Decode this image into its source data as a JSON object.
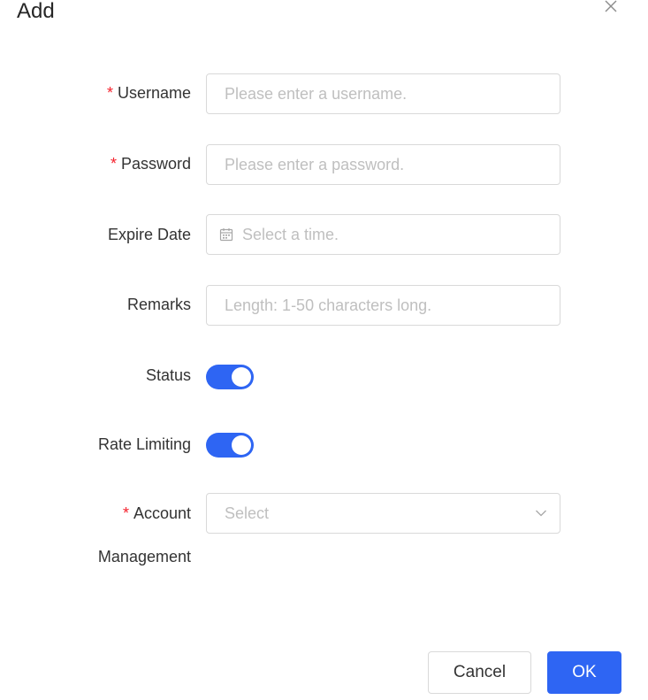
{
  "dialog": {
    "title": "Add",
    "close_icon": "close-icon"
  },
  "form": {
    "username": {
      "required_mark": "*",
      "label": "Username",
      "placeholder": "Please enter a username.",
      "value": ""
    },
    "password": {
      "required_mark": "*",
      "label": "Password",
      "placeholder": "Please enter a password.",
      "value": ""
    },
    "expire_date": {
      "label": "Expire Date",
      "placeholder": "Select a time.",
      "icon": "calendar-icon",
      "value": ""
    },
    "remarks": {
      "label": "Remarks",
      "placeholder": "Length: 1-50 characters long.",
      "value": ""
    },
    "status": {
      "label": "Status",
      "enabled": true
    },
    "rate_limiting": {
      "label": "Rate Limiting",
      "enabled": true
    },
    "account_management": {
      "required_mark": "*",
      "label_line1": "Account",
      "label_line2": "Management",
      "placeholder": "Select",
      "icon": "chevron-down-icon"
    }
  },
  "footer": {
    "cancel_label": "Cancel",
    "ok_label": "OK"
  },
  "colors": {
    "primary": "#2e65f3",
    "required": "#f5222d",
    "placeholder": "#bfbfbf",
    "border": "#d9d9d9"
  }
}
